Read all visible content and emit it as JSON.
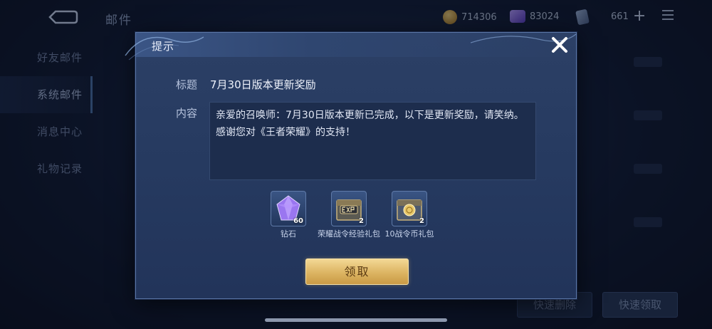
{
  "topbar": {
    "title": "邮件",
    "gold": "714306",
    "diamonds": "83024",
    "points": "661"
  },
  "sidebar": {
    "items": [
      {
        "label": "好友邮件",
        "active": false
      },
      {
        "label": "系统邮件",
        "active": true
      },
      {
        "label": "消息中心",
        "active": false
      },
      {
        "label": "礼物记录",
        "active": false
      }
    ]
  },
  "background": {
    "quick_delete": "快速删除",
    "quick_claim": "快速领取"
  },
  "dialog": {
    "title": "提示",
    "subject_label": "标题",
    "subject": "7月30日版本更新奖励",
    "content_label": "内容",
    "content": "亲爱的召唤师：7月30日版本更新已完成，以下是更新奖励，请笑纳。感谢您对《王者荣耀》的支持！",
    "rewards": [
      {
        "name": "钻石",
        "qty": "60",
        "icon": "diamond-icon"
      },
      {
        "name": "荣耀战令经验礼包",
        "qty": "2",
        "icon": "exp-chest-icon"
      },
      {
        "name": "10战令币礼包",
        "qty": "2",
        "icon": "coin-chest-icon"
      }
    ],
    "claim_label": "领取"
  },
  "colors": {
    "dialog_bg": "#2a3d63",
    "claim_gold": "#dcb462",
    "background": "#101a33"
  }
}
